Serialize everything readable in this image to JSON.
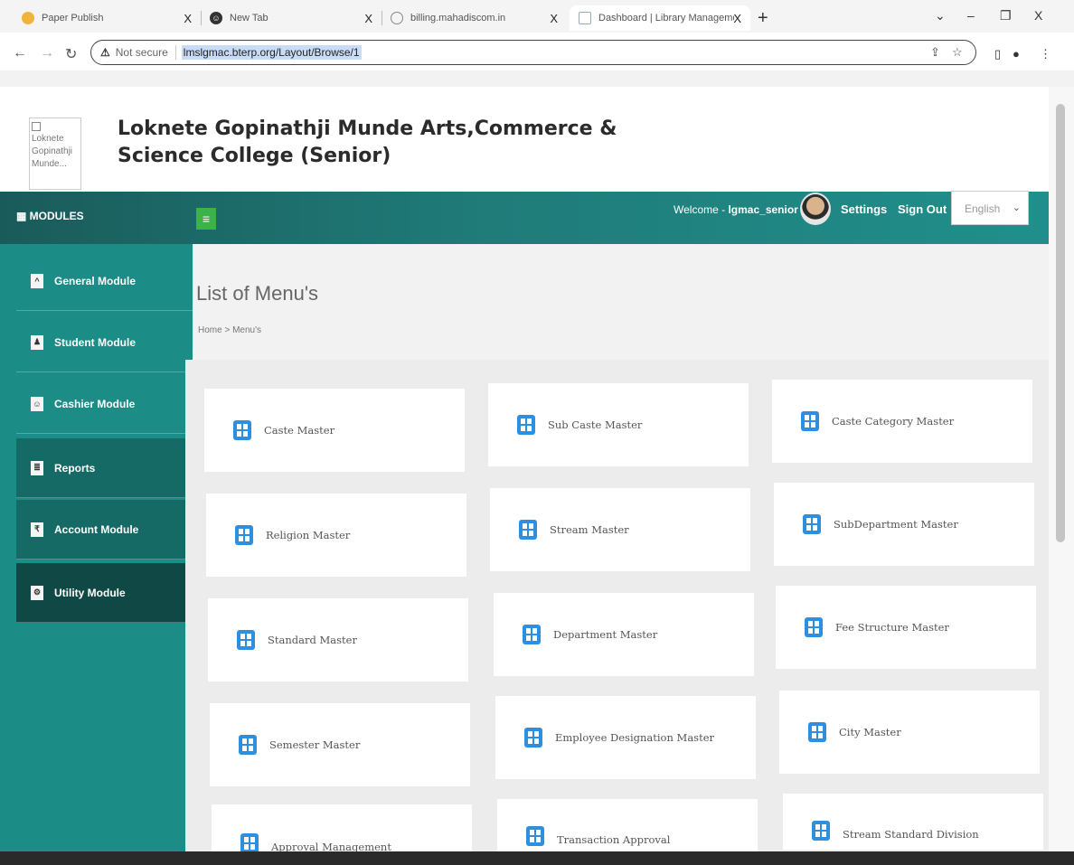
{
  "browser": {
    "tabs": [
      {
        "title": "Paper Publish",
        "icon": "paper-icon"
      },
      {
        "title": "New Tab",
        "icon": "new-tab-icon"
      },
      {
        "title": "billing.mahadiscom.in",
        "icon": "globe-icon"
      },
      {
        "title": "Dashboard | Library Managemen",
        "icon": "page-icon",
        "active": true
      }
    ],
    "close_glyph": "X",
    "new_tab_glyph": "+",
    "security_label": "Not secure",
    "url": "lmslgmac.bterp.org/Layout/Browse/1"
  },
  "site": {
    "logo_alt": "Loknete Gopinathji Munde...",
    "college_line1": "Loknete Gopinathji Munde Arts,Commerce &",
    "college_line2": "Science College (Senior)"
  },
  "topbar": {
    "modules_label": "MODULES",
    "welcome_prefix": "Welcome -",
    "username": "lgmac_senior",
    "settings_label": "Settings",
    "signout_label": "Sign Out",
    "language": "English"
  },
  "sidebar": {
    "items": [
      {
        "label": "General Module",
        "icon": "chevron-up-icon"
      },
      {
        "label": "Student Module",
        "icon": "student-icon"
      },
      {
        "label": "Cashier Module",
        "icon": "cashier-icon"
      },
      {
        "label": "Reports",
        "icon": "report-icon"
      },
      {
        "label": "Account Module",
        "icon": "account-icon"
      },
      {
        "label": "Utility Module",
        "icon": "utility-icon"
      }
    ]
  },
  "main": {
    "title": "List of Menu's",
    "breadcrumb": "Home > Menu's",
    "cards": [
      {
        "label": "Caste Master"
      },
      {
        "label": "Sub Caste Master"
      },
      {
        "label": "Caste Category Master"
      },
      {
        "label": "Religion Master"
      },
      {
        "label": "Stream Master"
      },
      {
        "label": "SubDepartment Master"
      },
      {
        "label": "Standard Master"
      },
      {
        "label": "Department Master"
      },
      {
        "label": "Fee Structure Master"
      },
      {
        "label": "Semester Master"
      },
      {
        "label": "Employee Designation Master"
      },
      {
        "label": "City Master"
      },
      {
        "label": "Approval Management"
      },
      {
        "label": "Transaction Approval"
      },
      {
        "label": "Stream Standard Division"
      }
    ]
  },
  "colors": {
    "teal_bar": "#1f7b78",
    "sidebar": "#1c8c87",
    "card_icon": "#2d8fde",
    "hamburger": "#3bb34a"
  }
}
